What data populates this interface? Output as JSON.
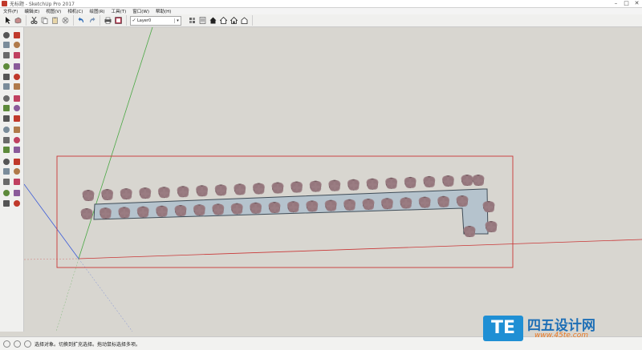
{
  "window": {
    "title": "无标题 - SketchUp Pro 2017",
    "controls": [
      "–",
      "□",
      "✕"
    ]
  },
  "menu": [
    "文件(F)",
    "编辑(E)",
    "视图(V)",
    "相机(C)",
    "绘图(R)",
    "工具(T)",
    "窗口(W)",
    "帮助(H)"
  ],
  "toolbar": {
    "layer_check": "✓",
    "layer_value": "Layer0",
    "layer_arrow": "▾",
    "icons": [
      "select-icon",
      "component-icon",
      "cut-icon",
      "copy-icon",
      "paste-icon",
      "erase-icon",
      "undo-icon",
      "redo-icon",
      "print-icon",
      "model-info-icon",
      "layer-icon",
      "components-icon",
      "3d-warehouse-icon",
      "home-icon",
      "house-outline-icon",
      "house-icon"
    ]
  },
  "left_toolbar": {
    "icons": [
      "select-tool-icon",
      "component-tool-icon",
      "paint-bucket-icon",
      "eraser-icon",
      "line-icon",
      "freehand-icon",
      "rectangle-icon",
      "rotated-rectangle-icon",
      "circle-icon",
      "polygon-icon",
      "arc-icon",
      "pie-icon",
      "move-icon",
      "push-pull-icon",
      "rotate-icon",
      "follow-me-icon",
      "scale-icon",
      "offset-icon",
      "tape-measure-icon",
      "dimension-icon",
      "protractor-icon",
      "text-icon",
      "axes-icon",
      "3d-text-icon",
      "orbit-icon",
      "pan-icon",
      "zoom-icon",
      "zoom-window-icon",
      "zoom-extents-icon",
      "previous-view-icon",
      "position-camera-icon",
      "walk-icon",
      "look-around-icon",
      "section-plane-icon"
    ]
  },
  "colors": {
    "viewport_bg": "#d8d6d0",
    "slab_fill": "#b5c3cd",
    "bbox": "#c93636",
    "axis_red": "#c93636",
    "axis_green": "#4aa844",
    "axis_blue": "#3b5bd8",
    "tree": "#8a6a70"
  },
  "status": {
    "text": "选择对象。切换到扩充选择。拖动鼠标选择多项。"
  },
  "watermark": {
    "logo": "TE",
    "name": "四五设计网",
    "url": "www.45te.com"
  }
}
